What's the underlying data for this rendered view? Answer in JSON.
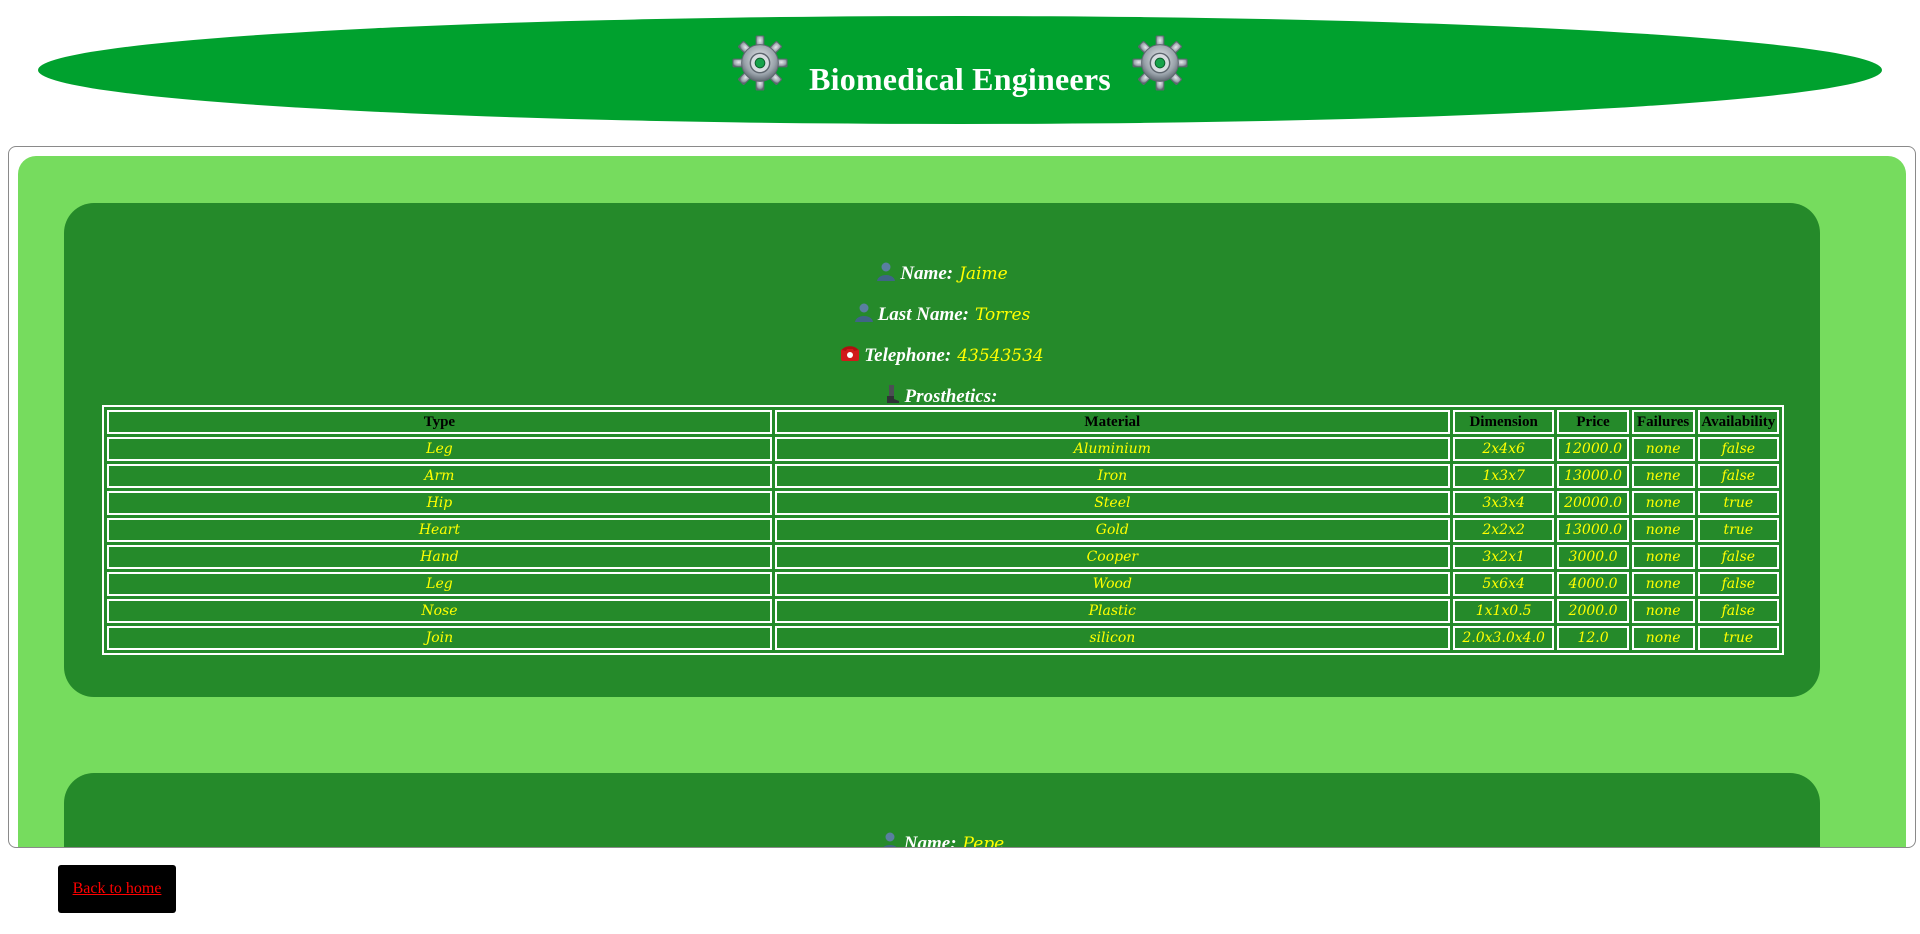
{
  "header": {
    "title": "Biomedical Engineers",
    "icon_left": "gear-icon",
    "icon_right": "gear-icon"
  },
  "engineers": [
    {
      "name_label": "Name:",
      "name": "Jaime",
      "lastname_label": "Last Name:",
      "lastname": "Torres",
      "telephone_label": "Telephone:",
      "telephone": "43543534",
      "prosthetics_label": "Prosthetics:",
      "prosthetics": {
        "columns": [
          "Type",
          "Material",
          "Dimension",
          "Price",
          "Failures",
          "Availability"
        ],
        "rows": [
          [
            "Leg",
            "Aluminium",
            "2x4x6",
            "12000.0",
            "none",
            "false"
          ],
          [
            "Arm",
            "Iron",
            "1x3x7",
            "13000.0",
            "nene",
            "false"
          ],
          [
            "Hip",
            "Steel",
            "3x3x4",
            "20000.0",
            "none",
            "true"
          ],
          [
            "Heart",
            "Gold",
            "2x2x2",
            "13000.0",
            "none",
            "true"
          ],
          [
            "Hand",
            "Cooper",
            "3x2x1",
            "3000.0",
            "none",
            "false"
          ],
          [
            "Leg",
            "Wood",
            "5x6x4",
            "4000.0",
            "none",
            "false"
          ],
          [
            "Nose",
            "Plastic",
            "1x1x0.5",
            "2000.0",
            "none",
            "false"
          ],
          [
            "Join",
            "silicon",
            "2.0x3.0x4.0",
            "12.0",
            "none",
            "true"
          ]
        ]
      }
    },
    {
      "name_label": "Name:",
      "name": "Pepe"
    }
  ],
  "footer": {
    "back_label": "Back to home"
  },
  "colors": {
    "banner": "#00a12e",
    "outer_panel": "#76dc5e",
    "card": "#258a2a",
    "value_text": "#ffff00",
    "button_bg": "#000000",
    "button_link": "#ff0000"
  }
}
